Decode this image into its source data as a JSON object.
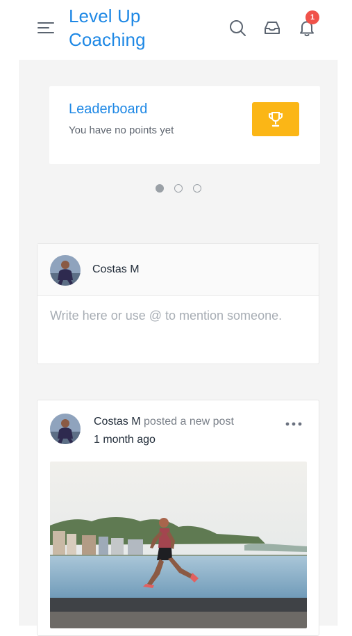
{
  "header": {
    "site_title": "Level Up Coaching",
    "icons": [
      "menu-icon",
      "search-icon",
      "inbox-icon",
      "bell-icon"
    ],
    "notification_count": "1"
  },
  "leaderboard": {
    "title": "Leaderboard",
    "subtitle": "You have no points yet",
    "icon": "trophy-icon"
  },
  "carousel": {
    "pages": 3,
    "active_index": 0
  },
  "composer": {
    "user_name": "Costas M",
    "placeholder": "Write here or use @ to mention someone."
  },
  "post": {
    "author": "Costas M",
    "action": "posted a new post",
    "time_ago": "1 month ago"
  },
  "colors": {
    "brand_blue": "#1e88e5",
    "trophy_yellow": "#fbb616",
    "badge_red": "#f0524a",
    "page_gray": "#f4f4f4"
  }
}
